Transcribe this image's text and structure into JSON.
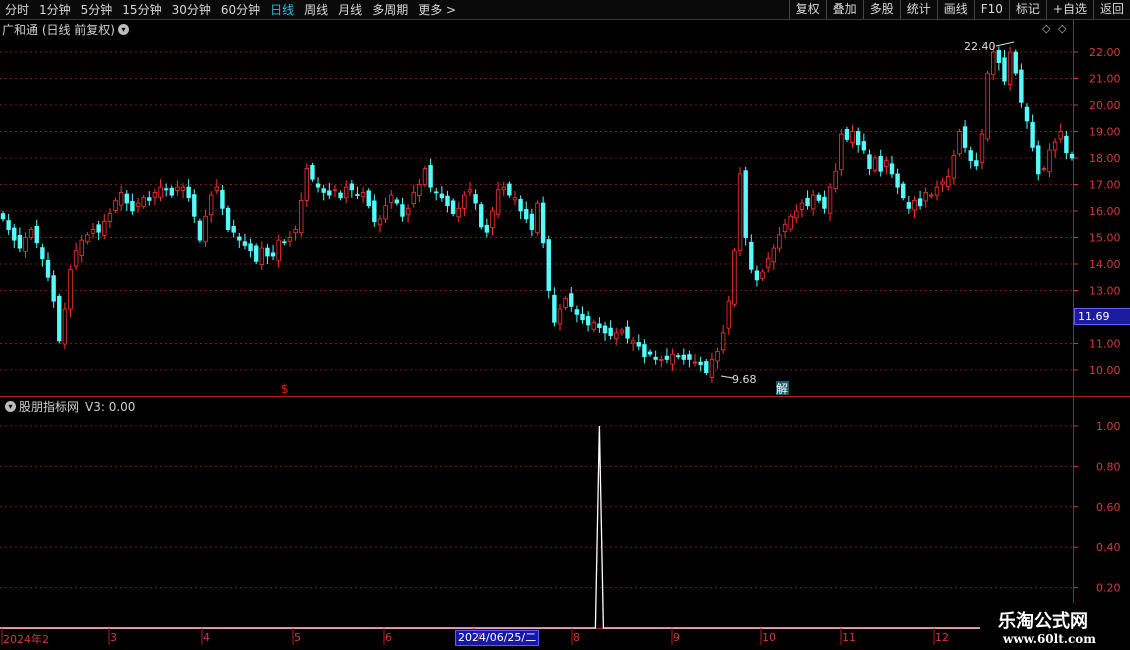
{
  "toolbar": {
    "periods": [
      "分时",
      "1分钟",
      "5分钟",
      "15分钟",
      "30分钟",
      "60分钟",
      "日线",
      "周线",
      "月线",
      "多周期",
      "更多 >"
    ],
    "active": "日线",
    "right_buttons": [
      "复权",
      "叠加",
      "多股",
      "统计",
      "画线",
      "F10",
      "标记",
      "+自选",
      "返回"
    ]
  },
  "main_pane": {
    "title": "广和通 (日线 前复权)",
    "price_axis": [
      "22.00",
      "21.00",
      "20.00",
      "19.00",
      "18.00",
      "17.00",
      "16.00",
      "15.00",
      "14.00",
      "13.00",
      "11.00",
      "10.00"
    ],
    "current_price": "11.69",
    "high_label": "22.40",
    "low_label": "9.68",
    "signal_mark": "$",
    "unlock_mark": "解",
    "colors": {
      "up": "#ff3232",
      "down": "#54fcfc",
      "grid": "#7a1a1a",
      "axis": "#d23b3b"
    }
  },
  "indicator_pane": {
    "title": "股朋指标网",
    "value_label": "V3: 0.00",
    "axis": [
      "1.00",
      "0.80",
      "0.60",
      "0.40",
      "0.20"
    ]
  },
  "date_axis": {
    "labels": [
      "2024年2",
      "3",
      "4",
      "5",
      "6",
      "7",
      "8",
      "9",
      "10",
      "11",
      "12"
    ],
    "crosshair_date": "2024/06/25/二"
  },
  "watermark": {
    "title": "乐淘公式网",
    "url": "www.60lt.com"
  },
  "chart_data": [
    {
      "type": "candlestick",
      "title": "广和通 (日线 前复权)",
      "y_range": [
        9.5,
        22.6
      ],
      "closes": [
        15.7,
        15.3,
        14.9,
        14.6,
        15.0,
        15.3,
        14.8,
        14.2,
        13.5,
        12.6,
        11.1,
        12.3,
        13.8,
        14.5,
        14.9,
        15.1,
        15.3,
        15.2,
        15.6,
        15.9,
        16.4,
        16.7,
        16.3,
        16.0,
        16.3,
        16.5,
        16.4,
        16.7,
        16.9,
        16.8,
        16.6,
        16.9,
        16.9,
        16.5,
        15.8,
        14.9,
        15.8,
        16.6,
        16.9,
        16.1,
        15.3,
        15.2,
        14.9,
        14.7,
        14.5,
        14.1,
        14.6,
        14.3,
        14.3,
        14.9,
        14.8,
        15.0,
        15.3,
        16.4,
        17.6,
        17.2,
        16.9,
        16.7,
        16.6,
        16.8,
        16.5,
        16.9,
        16.8,
        16.6,
        16.7,
        16.2,
        15.6,
        15.7,
        16.2,
        16.6,
        16.3,
        15.8,
        16.1,
        16.7,
        17.0,
        17.6,
        16.9,
        16.7,
        16.5,
        16.2,
        15.9,
        16.1,
        16.6,
        16.8,
        16.3,
        15.4,
        15.2,
        16.0,
        16.8,
        16.9,
        16.6,
        16.5,
        16.0,
        15.7,
        15.3,
        16.3,
        14.8,
        13.0,
        11.8,
        12.3,
        12.7,
        12.4,
        12.1,
        11.9,
        11.7,
        11.8,
        11.6,
        11.4,
        11.3,
        11.4,
        11.5,
        11.2,
        11.1,
        10.9,
        10.5,
        10.6,
        10.4,
        10.4,
        10.4,
        10.6,
        10.5,
        10.4,
        10.4,
        10.3,
        10.2,
        9.9,
        10.4,
        10.7,
        11.4,
        12.6,
        14.5,
        17.4,
        15.0,
        13.8,
        13.4,
        13.7,
        14.2,
        14.6,
        15.1,
        15.5,
        15.8,
        16.0,
        16.3,
        16.2,
        16.6,
        16.4,
        16.1,
        16.9,
        17.5,
        18.9,
        18.7,
        19.0,
        18.5,
        18.3,
        17.6,
        18.0,
        17.5,
        17.9,
        17.4,
        16.9,
        16.5,
        16.1,
        16.4,
        16.2,
        16.7,
        16.6,
        16.9,
        17.1,
        17.3,
        18.1,
        19.0,
        18.4,
        17.9,
        17.7,
        18.9,
        21.2,
        22.0,
        21.6,
        20.9,
        22.0,
        21.2,
        20.1,
        19.4,
        18.4,
        17.4,
        17.6,
        18.3,
        18.6,
        19.0,
        18.2,
        18.0
      ]
    },
    {
      "type": "line",
      "title": "股朋指标网",
      "series": [
        {
          "name": "V3",
          "spike_index": 106,
          "values_note": "0 everywhere except 1.00 at the spike"
        }
      ],
      "ylim": [
        0,
        1.05
      ]
    }
  ]
}
